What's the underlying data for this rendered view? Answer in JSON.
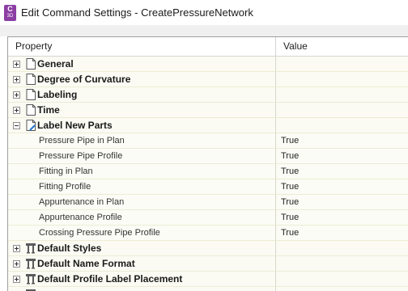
{
  "window": {
    "title": "Edit Command Settings - CreatePressureNetwork",
    "app_icon": {
      "letter": "C",
      "sub": "3D"
    }
  },
  "columns": {
    "property": "Property",
    "value": "Value"
  },
  "groups_top": [
    {
      "label": "General",
      "icon": "page-icon"
    },
    {
      "label": "Degree of Curvature",
      "icon": "page-icon"
    },
    {
      "label": "Labeling",
      "icon": "page-icon"
    },
    {
      "label": "Time",
      "icon": "page-icon"
    }
  ],
  "expanded_group": {
    "label": "Label New Parts",
    "icon": "page-edit-icon",
    "items": [
      {
        "name": "Pressure Pipe in Plan",
        "value": "True"
      },
      {
        "name": "Pressure Pipe Profile",
        "value": "True"
      },
      {
        "name": "Fitting in Plan",
        "value": "True"
      },
      {
        "name": "Fitting Profile",
        "value": "True"
      },
      {
        "name": "Appurtenance in Plan",
        "value": "True"
      },
      {
        "name": "Appurtenance Profile",
        "value": "True"
      },
      {
        "name": "Crossing Pressure Pipe Profile",
        "value": "True"
      }
    ]
  },
  "groups_bottom": [
    {
      "label": "Default Styles",
      "icon": "table-icon"
    },
    {
      "label": "Default Name Format",
      "icon": "table-icon"
    },
    {
      "label": "Default Profile Label Placement",
      "icon": "table-icon"
    }
  ],
  "colors": {
    "accent": "#8c3ea3",
    "row_bg": "#fbfbf4",
    "grid_line": "#ececd4"
  }
}
